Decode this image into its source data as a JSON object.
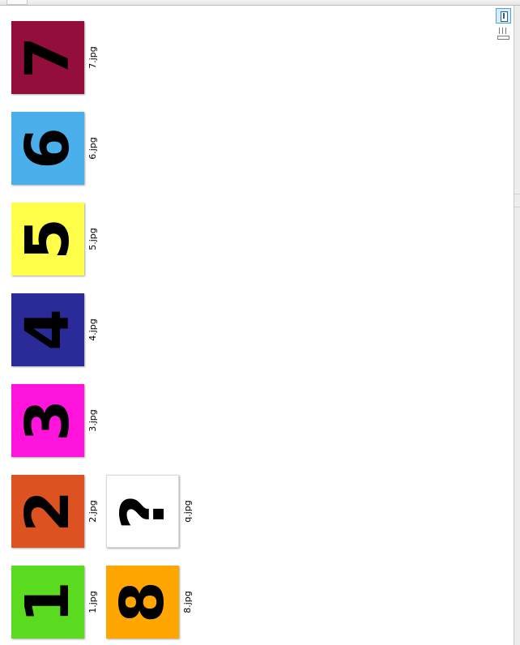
{
  "files": [
    {
      "name": "7.jpg",
      "digit": "7",
      "color": "#930D3D"
    },
    {
      "name": "6.jpg",
      "digit": "6",
      "color": "#4BAFEC"
    },
    {
      "name": "5.jpg",
      "digit": "5",
      "color": "#FFFF4A"
    },
    {
      "name": "4.jpg",
      "digit": "4",
      "color": "#2A2B98"
    },
    {
      "name": "3.jpg",
      "digit": "3",
      "color": "#FF14DC"
    },
    {
      "name": "2.jpg",
      "digit": "2",
      "color": "#DC5220"
    },
    {
      "name": "q.jpg",
      "digit": "?",
      "color": "#FFFFFF"
    },
    {
      "name": "1.jpg",
      "digit": "1",
      "color": "#5BDB1F"
    },
    {
      "name": "8.jpg",
      "digit": "8",
      "color": "#FFA600"
    }
  ],
  "view_controls": {
    "thumbnail_view_icon": "thumbnail-view-icon",
    "list_view_icon": "list-view-icon"
  }
}
